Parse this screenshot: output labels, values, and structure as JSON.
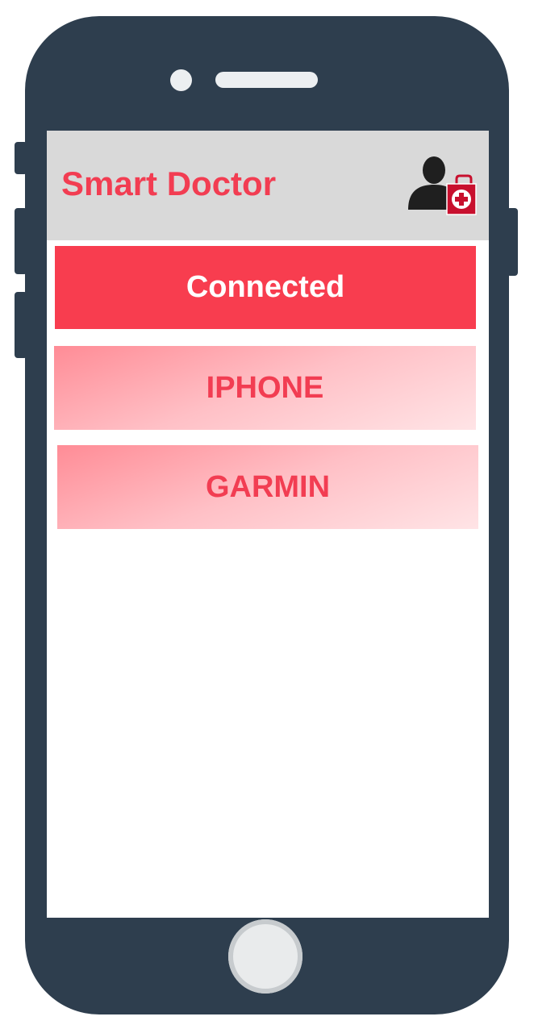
{
  "app": {
    "title": "Smart Doctor",
    "profile_icon": "doctor-with-medical-kit-icon"
  },
  "connection": {
    "status": "Connected"
  },
  "devices": [
    {
      "label": "IPHONE"
    },
    {
      "label": "GARMIN"
    }
  ],
  "colors": {
    "accent": "#f23d52",
    "banner": "#f83d4f",
    "phone_body": "#2e3e4e",
    "appbar": "#d9d9d9",
    "device_gradient_start": "#ff8c96",
    "device_gradient_end": "#ffe4e6"
  }
}
